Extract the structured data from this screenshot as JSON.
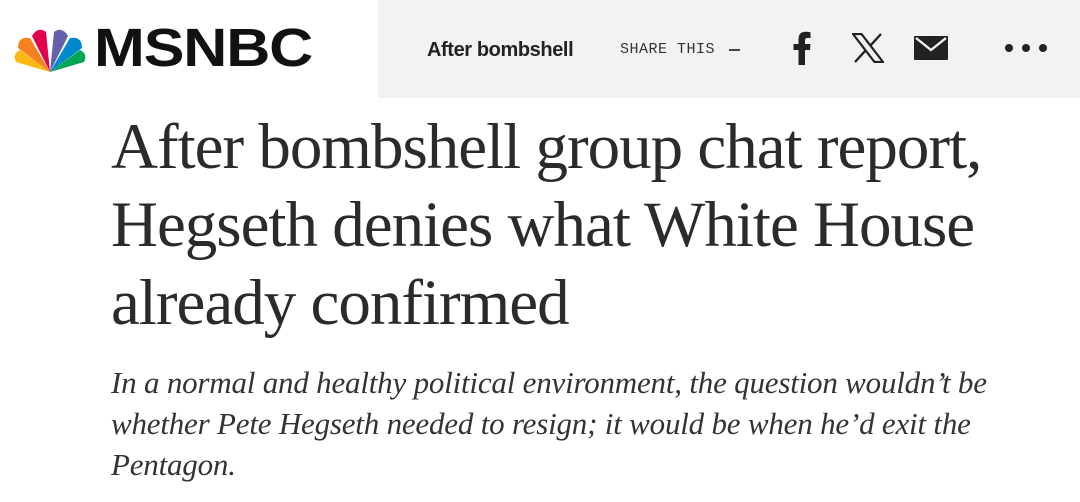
{
  "header": {
    "brand": "MSNBC",
    "logo_icon": "nbc-peacock-icon",
    "short_title": "After bombshell",
    "share_label": "SHARE THIS",
    "share_icons": [
      "facebook-icon",
      "x-icon",
      "mail-icon",
      "more-icon"
    ]
  },
  "article": {
    "headline": "After bombshell group chat report, Hegseth denies what White House already confirmed",
    "dek": "In a normal and healthy political environment, the question wouldn’t be whether Pete Hegseth needed to resign; it would be when he’d exit the Pentagon."
  },
  "colors": {
    "topbar_bg": "#f2f2f2",
    "peacock": [
      "#e0004d",
      "#f58220",
      "#fcb711",
      "#00a651",
      "#0089d0",
      "#6460aa"
    ]
  }
}
